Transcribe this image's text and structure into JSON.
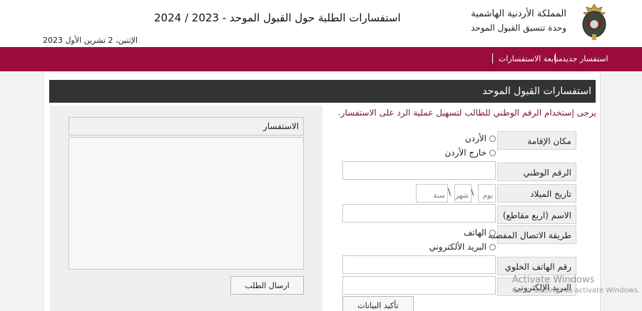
{
  "header": {
    "kingdom": "المملكة الأردنية الهاشمية",
    "unit": "وحدة تنسيق القبول الموحد",
    "title": "استفسارات الطلبة حول القبول الموحد - 2023 / 2024",
    "date": "الإثنين، 2 تشرين الأول 2023"
  },
  "nav": {
    "new_inquiry": "استفسار جديد",
    "follow_up": "متابعة الاستفسارات"
  },
  "panel": {
    "heading": "استفسارات القبول الموحد",
    "note": "يرجى إستخدام الرقم الوطني للطالب لتسهيل عملية الرد على الاستفسار."
  },
  "form": {
    "residence_label": "مكان الإقامة",
    "residence_options": [
      "الأردن",
      "خارج الأردن"
    ],
    "national_id_label": "الرقم الوطني",
    "birthdate_label": "تاريخ الميلاد",
    "day_placeholder": "يوم",
    "month_placeholder": "شهر",
    "year_placeholder": "سنة",
    "date_separator": "\\",
    "name_label": "الاسم (اربع مقاطع)",
    "contact_label": "طريقة الاتصال المفضلة",
    "contact_options": [
      "الهاتف",
      "البريد الألكتروني"
    ],
    "mobile_label": "رقم الهاتف الخلوي",
    "email_label": "البريد الإلكتروني",
    "confirm_button": "تأكيد البيانات"
  },
  "inquiry": {
    "label": "الاستفسار",
    "send_button": "ارسال الطلب"
  },
  "watermark": {
    "line1": "Activate Windows",
    "line2": "Go to Settings to activate Windows."
  },
  "colors": {
    "brand": "#9a0d3b",
    "panel_header": "#333333",
    "note_text": "#7a1530"
  }
}
